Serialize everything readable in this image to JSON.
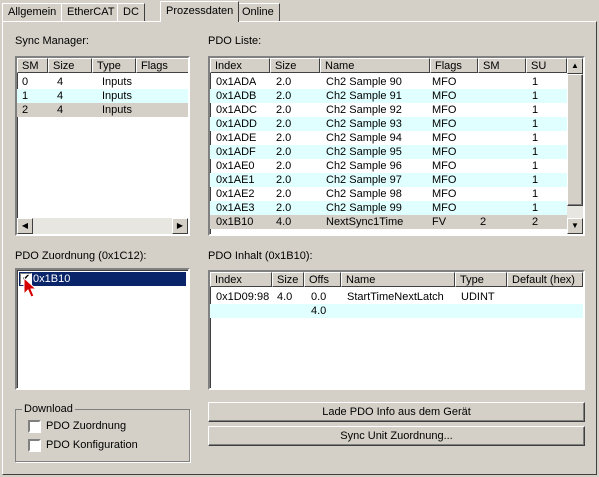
{
  "tabs": [
    "Allgemein",
    "EtherCAT",
    "DC",
    "Prozessdaten",
    "Online"
  ],
  "sync_manager": {
    "label": "Sync Manager:",
    "columns": [
      "SM",
      "Size",
      "Type",
      "Flags"
    ],
    "rows": [
      [
        "0",
        "4",
        "Inputs",
        ""
      ],
      [
        "1",
        "4",
        "Inputs",
        ""
      ],
      [
        "2",
        "4",
        "Inputs",
        ""
      ]
    ]
  },
  "pdo_liste": {
    "label": "PDO Liste:",
    "columns": [
      "Index",
      "Size",
      "Name",
      "Flags",
      "SM",
      "SU"
    ],
    "rows": [
      [
        "0x1ADA",
        "2.0",
        "Ch2 Sample 90",
        "MFO",
        "",
        "1"
      ],
      [
        "0x1ADB",
        "2.0",
        "Ch2 Sample 91",
        "MFO",
        "",
        "1"
      ],
      [
        "0x1ADC",
        "2.0",
        "Ch2 Sample 92",
        "MFO",
        "",
        "1"
      ],
      [
        "0x1ADD",
        "2.0",
        "Ch2 Sample 93",
        "MFO",
        "",
        "1"
      ],
      [
        "0x1ADE",
        "2.0",
        "Ch2 Sample 94",
        "MFO",
        "",
        "1"
      ],
      [
        "0x1ADF",
        "2.0",
        "Ch2 Sample 95",
        "MFO",
        "",
        "1"
      ],
      [
        "0x1AE0",
        "2.0",
        "Ch2 Sample 96",
        "MFO",
        "",
        "1"
      ],
      [
        "0x1AE1",
        "2.0",
        "Ch2 Sample 97",
        "MFO",
        "",
        "1"
      ],
      [
        "0x1AE2",
        "2.0",
        "Ch2 Sample 98",
        "MFO",
        "",
        "1"
      ],
      [
        "0x1AE3",
        "2.0",
        "Ch2 Sample 99",
        "MFO",
        "",
        "1"
      ],
      [
        "0x1B10",
        "4.0",
        "NextSync1Time",
        "FV",
        "2",
        "2"
      ]
    ]
  },
  "pdo_zuordnung": {
    "label": "PDO Zuordnung (0x1C12):",
    "items": [
      {
        "label": "0x1B10",
        "checked": true
      }
    ]
  },
  "pdo_inhalt": {
    "label": "PDO Inhalt (0x1B10):",
    "columns": [
      "Index",
      "Size",
      "Offs",
      "Name",
      "Type",
      "Default (hex)"
    ],
    "rows": [
      [
        "0x1D09:98",
        "4.0",
        "0.0",
        "StartTimeNextLatch",
        "UDINT",
        ""
      ],
      [
        "",
        "",
        "4.0",
        "",
        "",
        ""
      ]
    ]
  },
  "download": {
    "label": "Download",
    "options": [
      {
        "label": "PDO Zuordnung",
        "checked": false
      },
      {
        "label": "PDO Konfiguration",
        "checked": false
      }
    ]
  },
  "buttons": {
    "lade": "Lade PDO Info aus dem Gerät",
    "sync_unit": "Sync Unit Zuordnung..."
  }
}
